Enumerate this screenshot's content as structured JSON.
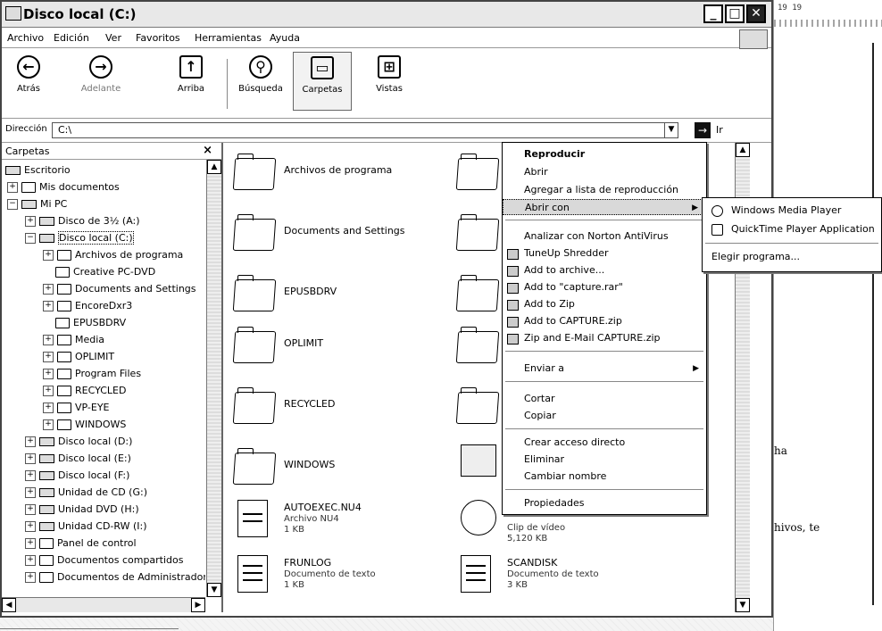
{
  "window": {
    "title": "Disco local (C:)",
    "controls": {
      "minimize": "_",
      "maximize": "□",
      "close": "✕"
    }
  },
  "menubar": [
    "Archivo",
    "Edición",
    "Ver",
    "Favoritos",
    "Herramientas",
    "Ayuda"
  ],
  "toolbar": {
    "back": "Atrás",
    "forward": "Adelante",
    "up": "Arriba",
    "search": "Búsqueda",
    "folders": "Carpetas",
    "views": "Vistas"
  },
  "address": {
    "label": "Dirección",
    "value": "C:\\",
    "go": "Ir"
  },
  "folders_pane": {
    "title": "Carpetas",
    "close": "×",
    "tree": [
      "Escritorio",
      "Mis documentos",
      "Mi PC",
      "Disco de 3½ (A:)",
      "Disco local (C:)",
      "Archivos de programa",
      "Creative PC-DVD",
      "Documents and Settings",
      "EncoreDxr3",
      "EPUSBDRV",
      "Media",
      "OPLIMIT",
      "Program Files",
      "RECYCLED",
      "VP-EYE",
      "WINDOWS",
      "Disco local (D:)",
      "Disco local (E:)",
      "Disco local (F:)",
      "Unidad de CD (G:)",
      "Unidad DVD (H:)",
      "Unidad CD-RW (I:)",
      "Panel de control",
      "Documentos compartidos",
      "Documentos de Administrador"
    ]
  },
  "files": [
    {
      "name": "Archivos de programa"
    },
    {
      "name": "Documents and Settings"
    },
    {
      "name": "EPUSBDRV"
    },
    {
      "name": "OPLIMIT"
    },
    {
      "name": "RECYCLED"
    },
    {
      "name": "WINDOWS"
    },
    {
      "name": "AUTOEXEC.NU4",
      "type": "Archivo NU4",
      "size": "1 KB"
    },
    {
      "name": "FRUNLOG",
      "type": "Documento de texto",
      "size": "1 KB"
    }
  ],
  "files_right": [
    {
      "name": "",
      "type": "Clip de vídeo",
      "size": "5,120 KB"
    },
    {
      "name": "SCANDISK",
      "type": "Documento de texto",
      "size": "3 KB"
    }
  ],
  "context_menu": {
    "items": [
      "Reproducir",
      "Abrir",
      "Agregar a lista de reproducción",
      "Abrir con",
      "Analizar con Norton AntiVirus",
      "TuneUp Shredder",
      "Add to archive...",
      "Add to \"capture.rar\"",
      "Add to Zip",
      "Add to CAPTURE.zip",
      "Zip and E-Mail CAPTURE.zip",
      "Enviar a",
      "Cortar",
      "Copiar",
      "Crear acceso directo",
      "Eliminar",
      "Cambiar nombre",
      "Propiedades"
    ]
  },
  "submenu": {
    "items": [
      "Windows Media Player",
      "QuickTime Player Application",
      "Elegir programa..."
    ]
  },
  "background_window": {
    "ruler": "19  19",
    "text1": "ha",
    "text2": "hivos, te"
  }
}
